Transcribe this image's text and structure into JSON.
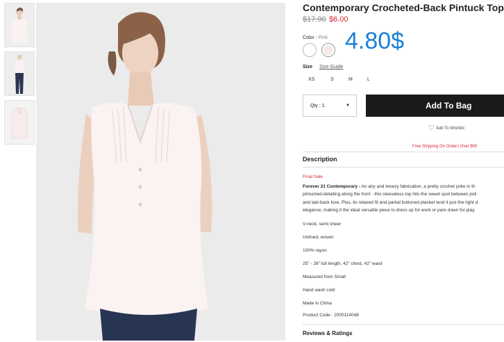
{
  "product": {
    "title": "Contemporary Crocheted-Back Pintuck Top",
    "price_original": "$17.90",
    "price_sale": "$6.00",
    "overlay_price": "4.80$"
  },
  "color": {
    "label": "Color :",
    "selected": "Pink",
    "swatches": [
      "white",
      "pink"
    ]
  },
  "size": {
    "label": "Size",
    "guide_link": "Size Guide",
    "options": [
      "XS",
      "S",
      "M",
      "L"
    ]
  },
  "quantity": {
    "value": "Qty : 1"
  },
  "actions": {
    "add_to_bag": "Add To Bag",
    "wishlist": "Add To Wishlist"
  },
  "promo": {
    "shipping": "Free Shipping On Orders Over $50"
  },
  "description": {
    "heading": "Description",
    "final_sale": "Final Sale",
    "brand": "Forever 21 Contemporary -",
    "lines": [
      " An airy and breezy fabrication, a pretty crochet yoke in th",
      "pintucked-detailing along the front - this sleeveless top hits the sweet spot between poli",
      "and laid-back luxe. Plus, its relaxed fit and partial buttoned placket lend it just the right d",
      "elegance, making it the ideal versatile piece to dress up for work or pare down for play."
    ],
    "specs": [
      "V-neck, semi sheer",
      "Unlined, woven",
      "100% rayon",
      "25\" - 28\" full length, 42\" chest, 42\" waist",
      "Measured from Small",
      "Hand wash cold",
      "Made in China"
    ],
    "product_code": "Product Code : 2000114048"
  },
  "reviews": {
    "heading": "Reviews & Ratings"
  },
  "colors": {
    "accent_red": "#d6262e",
    "overlay_blue": "#1a7fd8",
    "button_dark": "#1b1b1b"
  }
}
